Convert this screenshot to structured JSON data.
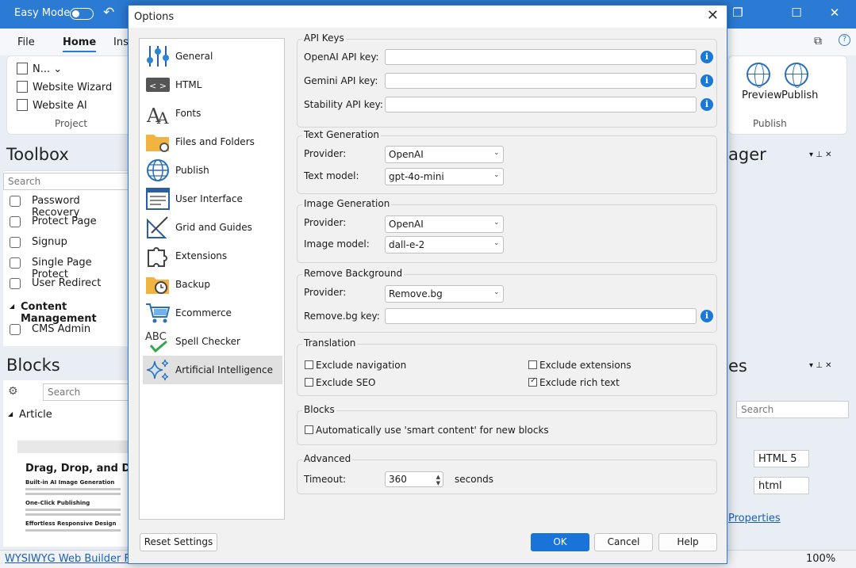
{
  "app": {
    "easy_mode": "Easy Mode",
    "menu": {
      "file": "File",
      "home": "Home",
      "insert": "Ins"
    },
    "ribbon_project": {
      "new": "N...",
      "wizard": "Website Wizard",
      "ai": "Website AI",
      "group": "Project"
    },
    "ribbon_publish": {
      "preview": "Preview",
      "publish": "Publish",
      "group": "Publish"
    },
    "toolbox": {
      "title": "Toolbox",
      "search": "Search",
      "items": [
        "Password Recovery",
        "Protect Page",
        "Signup",
        "Single Page Protect",
        "User Redirect"
      ],
      "category": "Content Management",
      "cms": "CMS Admin"
    },
    "blocks": {
      "title": "Blocks",
      "search": "Search",
      "category": "Article",
      "preview_heading": "Drag, Drop, and Dazzle",
      "preview_sub1": "Built-in AI Image Generation",
      "preview_sub2": "One-Click Publishing",
      "preview_sub3": "Effortless Responsive Design"
    },
    "right": {
      "manager_title": "ager",
      "props_title": "es",
      "search": "Search",
      "doctype": "HTML 5",
      "lang": "html",
      "properties_link": "Properties"
    },
    "status": {
      "link": "WYSIWYG Web Builder Fo",
      "zoom": "100%"
    }
  },
  "dialog": {
    "title": "Options",
    "categories": [
      {
        "label": "General",
        "icon": "sliders-icon"
      },
      {
        "label": "HTML",
        "icon": "code-icon"
      },
      {
        "label": "Fonts",
        "icon": "fonts-icon"
      },
      {
        "label": "Files and Folders",
        "icon": "folder-gear-icon"
      },
      {
        "label": "Publish",
        "icon": "globe-icon"
      },
      {
        "label": "User Interface",
        "icon": "ui-window-icon"
      },
      {
        "label": "Grid and Guides",
        "icon": "grid-ruler-icon"
      },
      {
        "label": "Extensions",
        "icon": "puzzle-icon"
      },
      {
        "label": "Backup",
        "icon": "backup-clock-icon"
      },
      {
        "label": "Ecommerce",
        "icon": "cart-icon"
      },
      {
        "label": "Spell Checker",
        "icon": "abc-check-icon"
      },
      {
        "label": "Artificial Intelligence",
        "icon": "sparkle-icon"
      }
    ],
    "selected_category": "Artificial Intelligence",
    "api_keys": {
      "title": "API Keys",
      "openai_label": "OpenAI API key:",
      "openai_value": "",
      "gemini_label": "Gemini API key:",
      "gemini_value": "",
      "stability_label": "Stability API key:",
      "stability_value": ""
    },
    "text_generation": {
      "title": "Text Generation",
      "provider_label": "Provider:",
      "provider_value": "OpenAI",
      "model_label": "Text model:",
      "model_value": "gpt-4o-mini"
    },
    "image_generation": {
      "title": "Image Generation",
      "provider_label": "Provider:",
      "provider_value": "OpenAI",
      "model_label": "Image model:",
      "model_value": "dall-e-2"
    },
    "remove_background": {
      "title": "Remove Background",
      "provider_label": "Provider:",
      "provider_value": "Remove.bg",
      "key_label": "Remove.bg key:",
      "key_value": ""
    },
    "translation": {
      "title": "Translation",
      "exclude_navigation": {
        "label": "Exclude navigation",
        "checked": false
      },
      "exclude_extensions": {
        "label": "Exclude extensions",
        "checked": false
      },
      "exclude_seo": {
        "label": "Exclude SEO",
        "checked": false
      },
      "exclude_rich_text": {
        "label": "Exclude rich text",
        "checked": true
      }
    },
    "blocks": {
      "title": "Blocks",
      "smart_content": {
        "label": "Automatically use 'smart content' for new blocks",
        "checked": false
      }
    },
    "advanced": {
      "title": "Advanced",
      "timeout_label": "Timeout:",
      "timeout_value": "360",
      "timeout_unit": "seconds"
    },
    "buttons": {
      "reset": "Reset Settings",
      "ok": "OK",
      "cancel": "Cancel",
      "help": "Help"
    },
    "colors": {
      "accent": "#1a73d8",
      "selected_row": "#e0e0e0"
    }
  }
}
